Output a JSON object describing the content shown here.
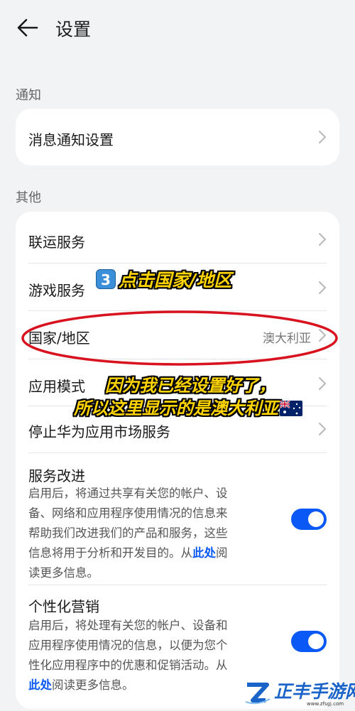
{
  "header": {
    "title": "设置"
  },
  "sections": {
    "notification_label": "通知",
    "other_label": "其他"
  },
  "notification_card": {
    "items": [
      {
        "label": "消息通知设置"
      }
    ]
  },
  "other_card": {
    "items": [
      {
        "label": "联运服务"
      },
      {
        "label": "游戏服务"
      },
      {
        "label": "国家/地区",
        "value": "澳大利亚"
      },
      {
        "label": "应用模式"
      },
      {
        "label": "停止华为应用市场服务"
      }
    ],
    "service_improvement": {
      "title": "服务改进",
      "desc_lines": [
        "启用后，将通过共享有关您的帐户、设",
        "备、网络和应用程序使用情况的信息来",
        "帮助我们改进我们的产品和服务，这些"
      ],
      "desc_last_prefix": "信息将用于分析和开发目的。从",
      "link_text": "此处",
      "desc_last_suffix": "阅",
      "desc_tail": "读更多信息。",
      "toggle_on": true
    },
    "personalized_marketing": {
      "title": "个性化营销",
      "desc_lines": [
        "启用后，将处理有关您的帐户、设备和",
        "应用程序使用情况的信息，以便为您个",
        "性化应用程序中的优惠和促销活动。从"
      ],
      "link_text": "此处",
      "desc_tail": "阅读更多信息。",
      "toggle_on": true
    }
  },
  "annotations": {
    "step_badge": "3",
    "step_text": "点击国家/地区",
    "note_line1": "因为我已经设置好了，",
    "note_line2": "所以这里显示的是澳大利亚"
  },
  "watermark": {
    "text": "正丰手游网",
    "url": "www.zfsgj.com"
  },
  "colors": {
    "accent": "#0a59f7",
    "background": "#f1f3f5",
    "annotation": "#ffd400",
    "highlight_circle": "#d8121f"
  },
  "icons": {
    "back": "arrow-left-icon",
    "row_nav": "chevron-right-icon",
    "flag": "australia-flag-icon",
    "watermark_logo": "z-logo-icon"
  }
}
